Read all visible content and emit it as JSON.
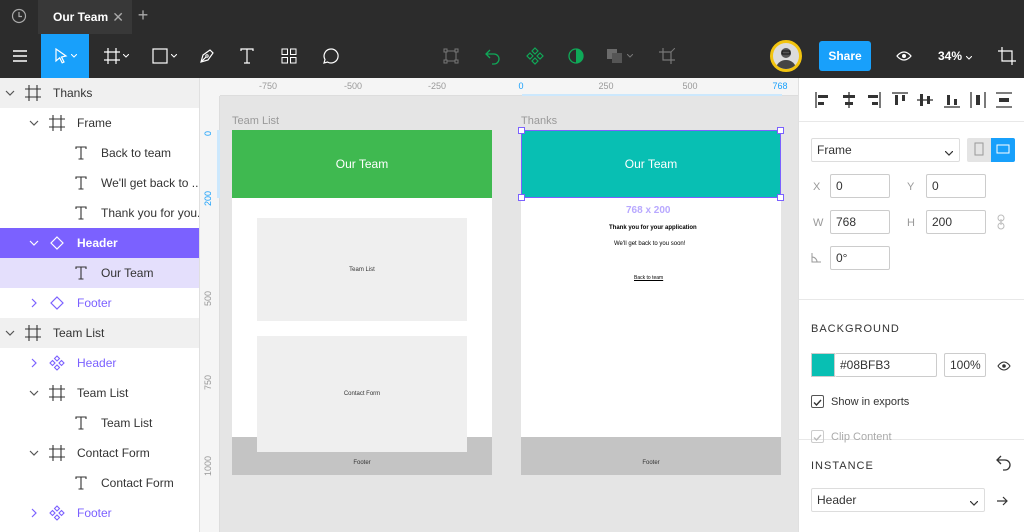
{
  "titlebar": {
    "tab_title": "Our Team",
    "close_glyph": "✕",
    "add_glyph": "+"
  },
  "toolbar": {
    "share_label": "Share",
    "zoom_label": "34%",
    "tools": [
      "menu-icon",
      "move-tool-icon",
      "frame-tool-icon",
      "shape-tool-icon",
      "pen-tool-icon",
      "text-tool-icon",
      "components-icon",
      "comment-icon"
    ],
    "component_tools": [
      "frame-selection-icon",
      "reset-instance-icon",
      "create-component-icon",
      "mask-icon",
      "boolean-icon",
      "crop-icon"
    ],
    "accent_color": "#18a0fb"
  },
  "layers": [
    {
      "label": "Thanks",
      "type": "frame",
      "depth": 0,
      "expanded": true,
      "style": "page"
    },
    {
      "label": "Frame",
      "type": "frame",
      "depth": 1,
      "expanded": true,
      "style": ""
    },
    {
      "label": "Back to team",
      "type": "text",
      "depth": 2,
      "style": ""
    },
    {
      "label": "We'll get back to ...",
      "type": "text",
      "depth": 2,
      "style": ""
    },
    {
      "label": "Thank you for you...",
      "type": "text",
      "depth": 2,
      "style": ""
    },
    {
      "label": "Header",
      "type": "instance",
      "depth": 1,
      "expanded": true,
      "style": "sel"
    },
    {
      "label": "Our Team",
      "type": "text",
      "depth": 2,
      "style": "sub"
    },
    {
      "label": "Footer",
      "type": "instance",
      "depth": 1,
      "expanded": false,
      "style": "comp"
    },
    {
      "label": "Team List",
      "type": "frame",
      "depth": 0,
      "expanded": true,
      "style": "page"
    },
    {
      "label": "Header",
      "type": "component",
      "depth": 1,
      "expanded": false,
      "style": "comp"
    },
    {
      "label": "Team List",
      "type": "frame",
      "depth": 1,
      "expanded": true,
      "style": ""
    },
    {
      "label": "Team List",
      "type": "text",
      "depth": 2,
      "style": ""
    },
    {
      "label": "Contact Form",
      "type": "frame",
      "depth": 1,
      "expanded": true,
      "style": ""
    },
    {
      "label": "Contact Form",
      "type": "text",
      "depth": 2,
      "style": ""
    },
    {
      "label": "Footer",
      "type": "component",
      "depth": 1,
      "expanded": false,
      "style": "comp"
    }
  ],
  "rulers": {
    "top": [
      "-750",
      "-500",
      "-250",
      "0",
      "250",
      "500",
      "768"
    ],
    "left": [
      "0",
      "200",
      "500",
      "750",
      "1000"
    ]
  },
  "canvas": {
    "frame1": {
      "label": "Team List",
      "header_text": "Our Team",
      "header_color": "#3fb950",
      "placeholder1": "Team List",
      "placeholder2": "Contact Form",
      "footer": "Footer"
    },
    "frame2": {
      "label": "Thanks",
      "header_text": "Our Team",
      "header_color": "#08bfb3",
      "dimensions": "768 x 200",
      "title": "Thank you for your application",
      "subtitle": "We'll get back to you soon!",
      "link": "Back to team",
      "footer": "Footer"
    }
  },
  "properties": {
    "frame_type": "Frame",
    "x_label": "X",
    "x_value": "0",
    "y_label": "Y",
    "y_value": "0",
    "w_label": "W",
    "w_value": "768",
    "h_label": "H",
    "h_value": "200",
    "rotation_value": "0°",
    "background_title": "BACKGROUND",
    "bg_hex": "#08BFB3",
    "bg_swatch": "#08bfb3",
    "bg_opacity": "100%",
    "show_in_exports": "Show in exports",
    "show_in_exports_checked": true,
    "clip_content": "Clip Content",
    "clip_content_checked": true,
    "instance_title": "INSTANCE",
    "instance_value": "Header"
  }
}
